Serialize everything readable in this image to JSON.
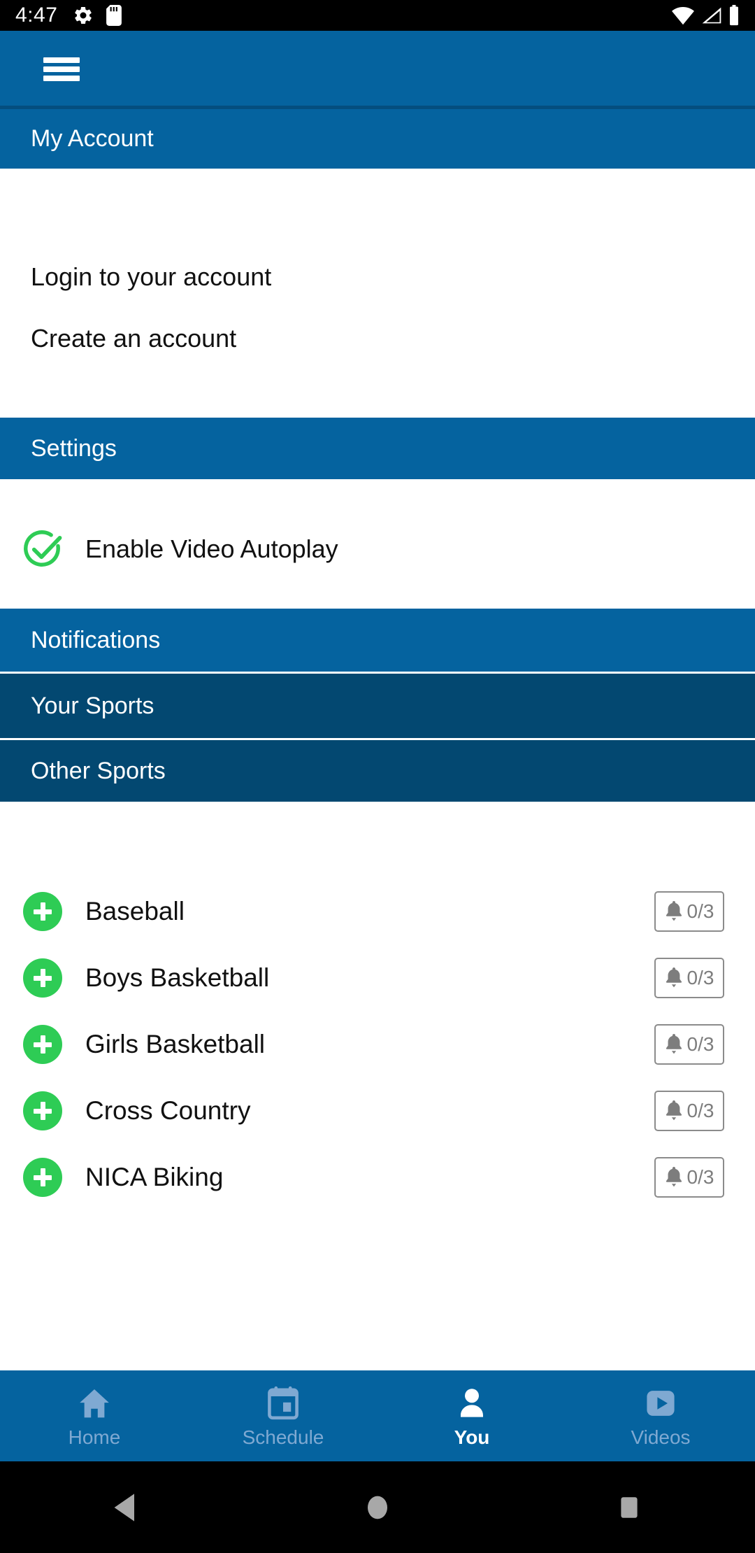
{
  "status_bar": {
    "time": "4:47",
    "left_icons": [
      "settings-gear-icon",
      "sd-card-icon"
    ],
    "right_icons": [
      "wifi-icon",
      "cell-signal-icon",
      "battery-icon"
    ]
  },
  "app_bar": {
    "menu_icon": "hamburger-menu-icon",
    "background_color": "#05639f"
  },
  "sections": {
    "my_account": "My Account",
    "settings": "Settings",
    "notifications": "Notifications",
    "your_sports": "Your Sports",
    "other_sports": "Other Sports"
  },
  "account": {
    "login": "Login to your account",
    "create": "Create an account"
  },
  "settings_items": {
    "autoplay_label": "Enable Video Autoplay",
    "autoplay_icon": "check-circle-icon",
    "autoplay_checked": true,
    "check_color": "#2ecc55"
  },
  "other_sports": [
    {
      "name": "Baseball",
      "add_icon": "plus-circle-icon",
      "bell_icon": "bell-icon",
      "count": "0/3"
    },
    {
      "name": "Boys Basketball",
      "add_icon": "plus-circle-icon",
      "bell_icon": "bell-icon",
      "count": "0/3"
    },
    {
      "name": "Girls Basketball",
      "add_icon": "plus-circle-icon",
      "bell_icon": "bell-icon",
      "count": "0/3"
    },
    {
      "name": "Cross Country",
      "add_icon": "plus-circle-icon",
      "bell_icon": "bell-icon",
      "count": "0/3"
    },
    {
      "name": "NICA Biking",
      "add_icon": "plus-circle-icon",
      "bell_icon": "bell-icon",
      "count": "0/3"
    }
  ],
  "bottom_nav": {
    "active": "You",
    "items": [
      {
        "label": "Home",
        "icon": "home-icon"
      },
      {
        "label": "Schedule",
        "icon": "calendar-icon"
      },
      {
        "label": "You",
        "icon": "person-icon"
      },
      {
        "label": "Videos",
        "icon": "play-video-icon"
      }
    ]
  },
  "android_nav": {
    "back": "back-triangle-icon",
    "home": "home-circle-icon",
    "recents": "recents-square-icon"
  },
  "colors": {
    "header_blue": "#05639f",
    "header_navy": "#034871",
    "accent_green": "#2ecc55",
    "badge_gray": "#8b8b8b",
    "nav_inactive": "#7fa9d2"
  }
}
